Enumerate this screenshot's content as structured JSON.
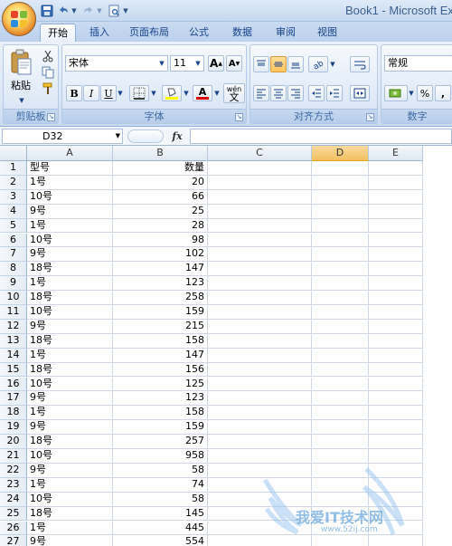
{
  "window": {
    "title": "Book1 - Microsoft Ex",
    "quick_access": [
      "save",
      "undo",
      "redo",
      "print-preview",
      "customize"
    ]
  },
  "tabs": [
    {
      "label": "开始",
      "active": true
    },
    {
      "label": "插入",
      "active": false
    },
    {
      "label": "页面布局",
      "active": false
    },
    {
      "label": "公式",
      "active": false
    },
    {
      "label": "数据",
      "active": false
    },
    {
      "label": "审阅",
      "active": false
    },
    {
      "label": "视图",
      "active": false
    }
  ],
  "ribbon": {
    "clipboard": {
      "group_label": "剪贴板",
      "paste_label": "粘贴"
    },
    "font": {
      "group_label": "字体",
      "font_name": "宋体",
      "font_size": "11",
      "bold": "B",
      "italic": "I",
      "underline": "U",
      "grow": "A",
      "shrink": "A",
      "font_color_letter": "A",
      "phonetic": "wén"
    },
    "alignment": {
      "group_label": "对齐方式"
    },
    "number": {
      "group_label": "数字",
      "format": "常规",
      "percent": "%",
      "comma": ","
    }
  },
  "formula_bar": {
    "name_box": "D32",
    "fx": "fx",
    "formula": ""
  },
  "sheet": {
    "columns": [
      "A",
      "B",
      "C",
      "D",
      "E"
    ],
    "selected_column": "D",
    "rows": [
      {
        "n": "1",
        "a": "型号",
        "b": "数量"
      },
      {
        "n": "2",
        "a": "1号",
        "b": "20"
      },
      {
        "n": "3",
        "a": "10号",
        "b": "66"
      },
      {
        "n": "4",
        "a": "9号",
        "b": "25"
      },
      {
        "n": "5",
        "a": "1号",
        "b": "28"
      },
      {
        "n": "6",
        "a": "10号",
        "b": "98"
      },
      {
        "n": "7",
        "a": "9号",
        "b": "102"
      },
      {
        "n": "8",
        "a": "18号",
        "b": "147"
      },
      {
        "n": "9",
        "a": "1号",
        "b": "123"
      },
      {
        "n": "10",
        "a": "18号",
        "b": "258"
      },
      {
        "n": "11",
        "a": "10号",
        "b": "159"
      },
      {
        "n": "12",
        "a": "9号",
        "b": "215"
      },
      {
        "n": "13",
        "a": "18号",
        "b": "158"
      },
      {
        "n": "14",
        "a": "1号",
        "b": "147"
      },
      {
        "n": "15",
        "a": "18号",
        "b": "156"
      },
      {
        "n": "16",
        "a": "10号",
        "b": "125"
      },
      {
        "n": "17",
        "a": "9号",
        "b": "123"
      },
      {
        "n": "18",
        "a": "1号",
        "b": "158"
      },
      {
        "n": "19",
        "a": "9号",
        "b": "159"
      },
      {
        "n": "20",
        "a": "18号",
        "b": "257"
      },
      {
        "n": "21",
        "a": "10号",
        "b": "958"
      },
      {
        "n": "22",
        "a": "9号",
        "b": "58"
      },
      {
        "n": "23",
        "a": "1号",
        "b": "74"
      },
      {
        "n": "24",
        "a": "10号",
        "b": "58"
      },
      {
        "n": "25",
        "a": "18号",
        "b": "145"
      },
      {
        "n": "26",
        "a": "1号",
        "b": "445"
      },
      {
        "n": "27",
        "a": "9号",
        "b": "554"
      }
    ]
  },
  "watermark": {
    "text": "我爱IT技术网",
    "url": "www.52ij.com"
  },
  "colors": {
    "accent_blue": "#15428b",
    "ribbon_bg": "#dbe6f5",
    "selected_header": "#f9d99f",
    "grid_line": "#d0d7e5"
  }
}
